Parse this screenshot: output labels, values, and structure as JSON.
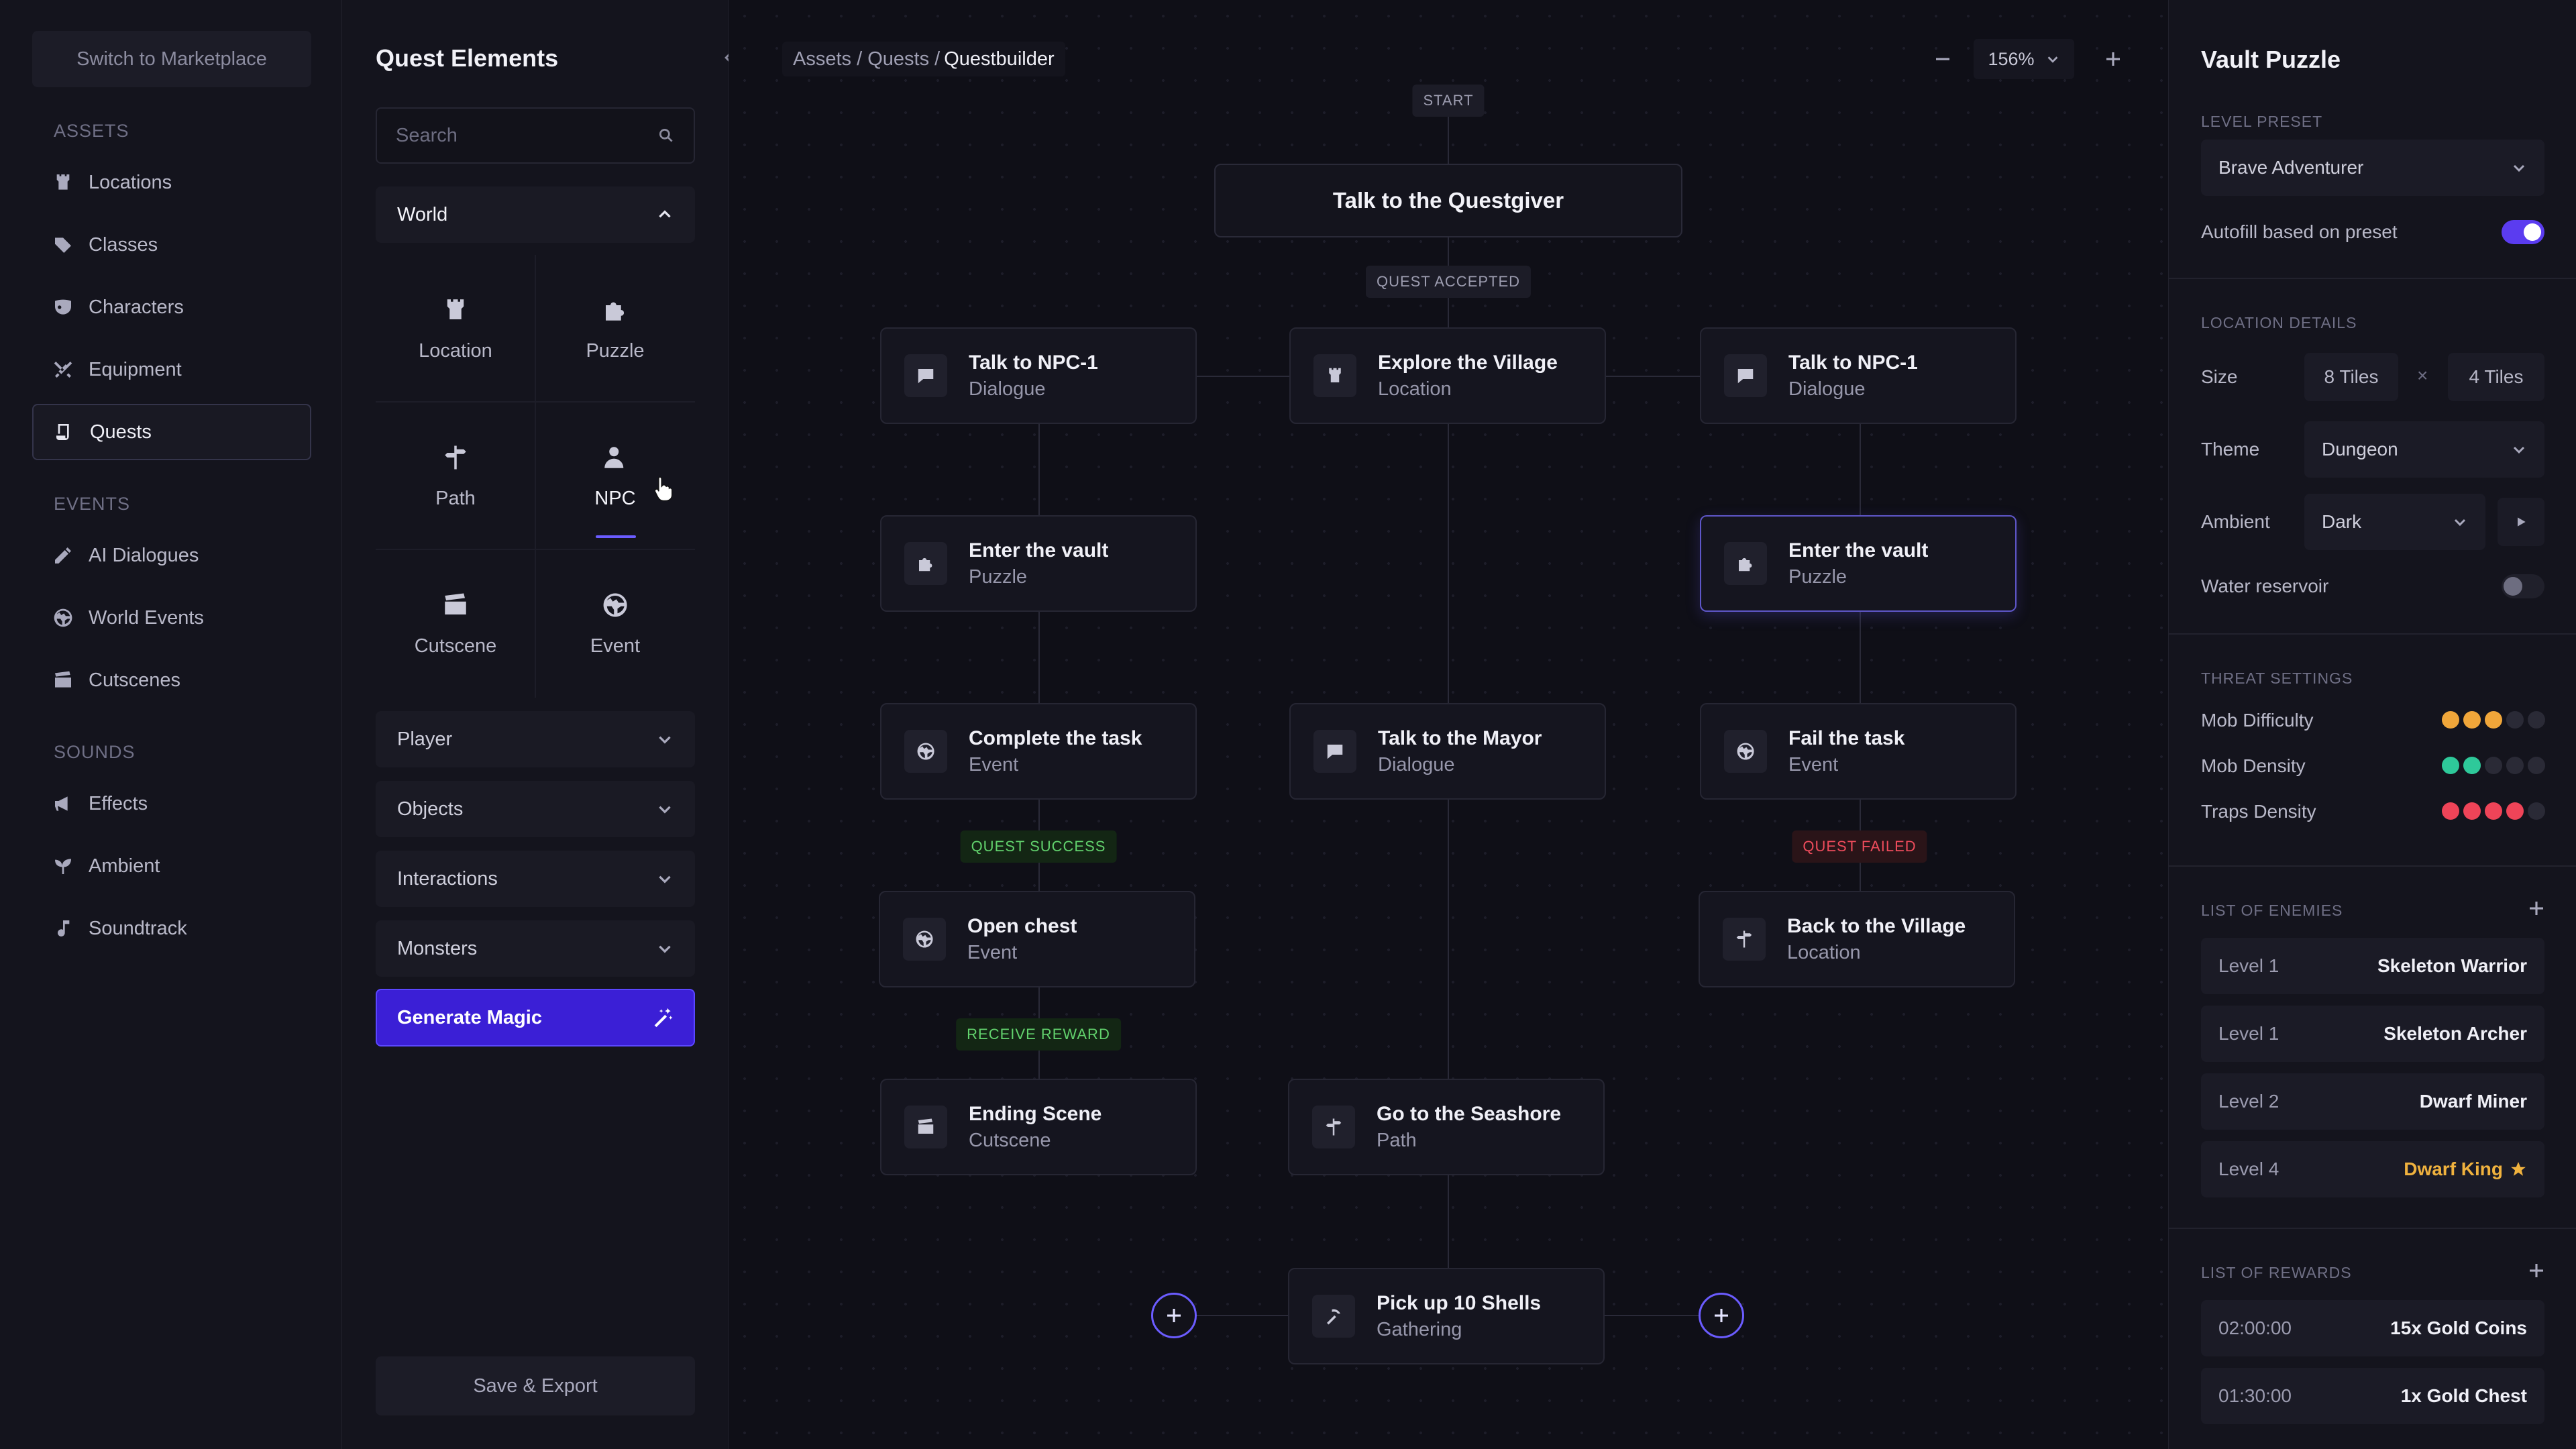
{
  "nav": {
    "marketplace_button": "Switch to Marketplace",
    "sections": [
      {
        "title": "ASSETS",
        "items": [
          {
            "label": "Locations",
            "icon": "tower-icon"
          },
          {
            "label": "Classes",
            "icon": "tag-icon"
          },
          {
            "label": "Characters",
            "icon": "mask-icon"
          },
          {
            "label": "Equipment",
            "icon": "swords-icon"
          },
          {
            "label": "Quests",
            "icon": "scroll-icon",
            "active": true
          }
        ]
      },
      {
        "title": "EVENTS",
        "items": [
          {
            "label": "AI Dialogues",
            "icon": "pencil-icon"
          },
          {
            "label": "World Events",
            "icon": "globe-icon"
          },
          {
            "label": "Cutscenes",
            "icon": "clapper-icon"
          }
        ]
      },
      {
        "title": "SOUNDS",
        "items": [
          {
            "label": "Effects",
            "icon": "megaphone-icon"
          },
          {
            "label": "Ambient",
            "icon": "sprout-icon"
          },
          {
            "label": "Soundtrack",
            "icon": "music-note-icon"
          }
        ]
      }
    ]
  },
  "elements_panel": {
    "title": "Quest Elements",
    "search_placeholder": "Search",
    "world_label": "World",
    "tiles": [
      {
        "label": "Location",
        "icon": "tower-icon"
      },
      {
        "label": "Puzzle",
        "icon": "puzzle-icon"
      },
      {
        "label": "Path",
        "icon": "signpost-icon"
      },
      {
        "label": "NPC",
        "icon": "person-icon",
        "active": true
      },
      {
        "label": "Cutscene",
        "icon": "clapper-icon"
      },
      {
        "label": "Event",
        "icon": "globe-icon"
      }
    ],
    "groups": [
      "Player",
      "Objects",
      "Interactions",
      "Monsters"
    ],
    "generate_label": "Generate Magic",
    "save_label": "Save & Export"
  },
  "canvas": {
    "breadcrumb": {
      "parts": "Assets / Quests /",
      "current": "Questbuilder"
    },
    "zoom": "156%",
    "start_tag": "START",
    "start_node": "Talk to the Questgiver",
    "accepted_tag": "QUEST ACCEPTED",
    "success_tag": "QUEST SUCCESS",
    "failed_tag": "QUEST FAILED",
    "reward_tag": "RECEIVE REWARD",
    "nodes": [
      {
        "title": "Talk to NPC-1",
        "type": "Dialogue",
        "icon": "chat-icon"
      },
      {
        "title": "Explore the Village",
        "type": "Location",
        "icon": "tower-icon"
      },
      {
        "title": "Talk to NPC-1",
        "type": "Dialogue",
        "icon": "chat-icon"
      },
      {
        "title": "Enter the vault",
        "type": "Puzzle",
        "icon": "puzzle-icon"
      },
      {
        "title": "Enter the vault",
        "type": "Puzzle",
        "icon": "puzzle-icon"
      },
      {
        "title": "Complete the task",
        "type": "Event",
        "icon": "globe-icon"
      },
      {
        "title": "Talk to the Mayor",
        "type": "Dialogue",
        "icon": "chat-icon"
      },
      {
        "title": "Fail the task",
        "type": "Event",
        "icon": "globe-icon"
      },
      {
        "title": "Open chest",
        "type": "Event",
        "icon": "globe-icon"
      },
      {
        "title": "Back to the Village",
        "type": "Location",
        "icon": "signpost-icon"
      },
      {
        "title": "Ending Scene",
        "type": "Cutscene",
        "icon": "clapper-icon"
      },
      {
        "title": "Go to the Seashore",
        "type": "Path",
        "icon": "signpost-icon"
      },
      {
        "title": "Pick up 10 Shells",
        "type": "Gathering",
        "icon": "pickaxe-icon"
      }
    ]
  },
  "props": {
    "title": "Vault Puzzle",
    "level_preset_label": "LEVEL PRESET",
    "level_preset_value": "Brave Adventurer",
    "autofill_label": "Autofill based on preset",
    "autofill_on": true,
    "location_details_label": "LOCATION DETAILS",
    "size_label": "Size",
    "size_w": "8 Tiles",
    "size_sep": "×",
    "size_h": "4 Tiles",
    "theme_label": "Theme",
    "theme_value": "Dungeon",
    "ambient_label": "Ambient",
    "ambient_value": "Dark",
    "water_label": "Water reservoir",
    "water_on": false,
    "threat_label": "THREAT SETTINGS",
    "threats": [
      {
        "label": "Mob Difficulty",
        "level": 3,
        "color": "#f0a63a"
      },
      {
        "label": "Mob Density",
        "level": 2,
        "color": "#2ec99a"
      },
      {
        "label": "Traps Density",
        "level": 4,
        "color": "#ef4458"
      }
    ],
    "enemies_label": "LIST OF ENEMIES",
    "enemies": [
      {
        "level": "Level 1",
        "name": "Skeleton Warrior"
      },
      {
        "level": "Level 1",
        "name": "Skeleton Archer"
      },
      {
        "level": "Level 2",
        "name": "Dwarf Miner"
      },
      {
        "level": "Level 4",
        "name": "Dwarf King",
        "boss": true
      }
    ],
    "rewards_label": "LIST OF REWARDS",
    "rewards": [
      {
        "time": "02:00:00",
        "item": "15x Gold Coins"
      },
      {
        "time": "01:30:00",
        "item": "1x Gold Chest"
      }
    ]
  }
}
